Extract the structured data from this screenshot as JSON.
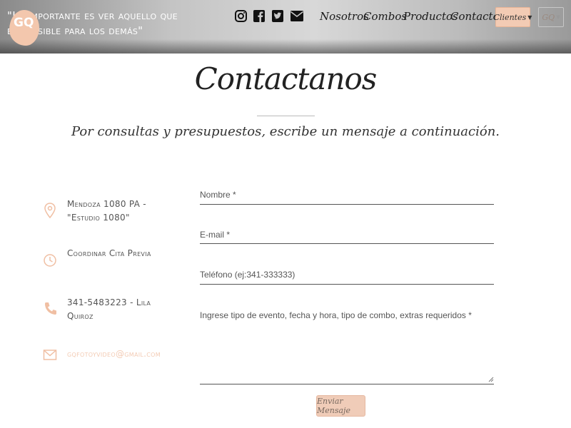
{
  "header": {
    "tagline": "\"Lo importante es ver aquello que es invisible para los demás\"",
    "logo_text": "GQ",
    "social_icons": [
      "instagram-icon",
      "facebook-icon",
      "twitter-icon",
      "envelope-icon"
    ],
    "nav": [
      "Nosotros",
      "Combos",
      "Productos",
      "Contacto"
    ],
    "clientes_label": "Clientes",
    "user_menu_label": "GQ"
  },
  "main": {
    "title": "Contactanos",
    "subtitle": "Por consultas y presupuestos, escribe un mensaje a continuación."
  },
  "contact_info": {
    "address": "Mendoza 1080 PA - \"Estudio 1080\"",
    "appointment": "Coordinar Cita Previa",
    "phone": "341-5483223 - Lila Quiroz",
    "email": "gqfotoyvideo@gmail.com"
  },
  "form": {
    "name_placeholder": "Nombre *",
    "email_placeholder": "E-mail *",
    "phone_placeholder": "Teléfono (ej:341-333333)",
    "message_placeholder": "Ingrese tipo de evento, fecha y hora, tipo de combo, extras requeridos *",
    "submit_label": "Enviar Mensaje"
  },
  "colors": {
    "accent": "#f3cbb4",
    "icon": "#f0bfa3"
  }
}
